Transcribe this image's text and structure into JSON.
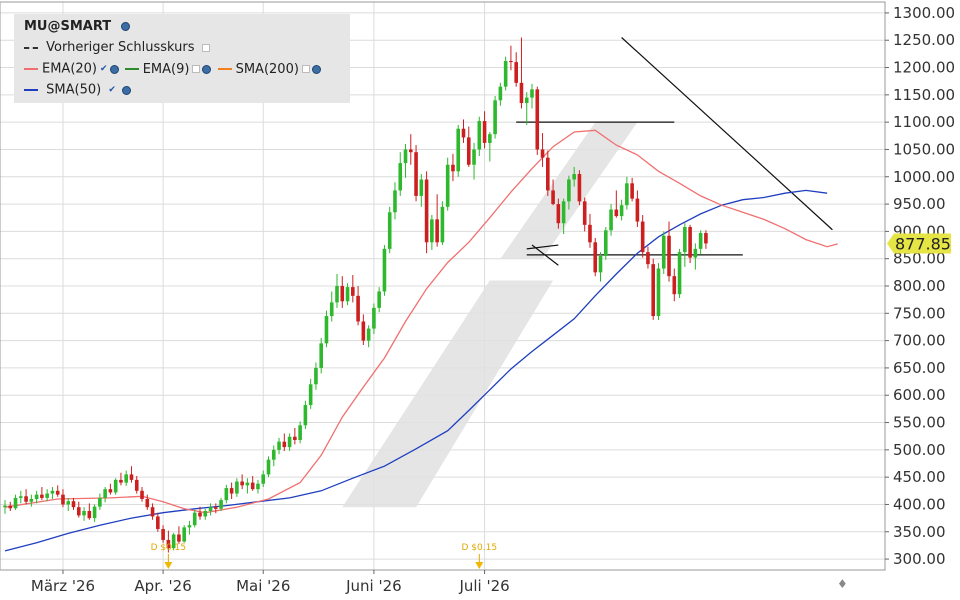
{
  "legend": {
    "title": "MU@SMART",
    "prev_close_label": "Vorheriger Schlusskurs",
    "ema20_label": "EMA(20)",
    "ema9_label": "EMA(9)",
    "sma200_label": "SMA(200)",
    "sma50_label": "SMA(50)"
  },
  "colors": {
    "up": "#2eb82e",
    "down": "#cc1f1f",
    "ema20": "#f07070",
    "ema9": "#2e8b2e",
    "sma200": "#f0821e",
    "sma50": "#1f3fbf",
    "channel": "#e0e0e0",
    "last_price_bg": "#e5e545"
  },
  "chart_data": {
    "type": "candlestick",
    "y_axis": {
      "min": 280,
      "max": 1320,
      "ticks": [
        "300.00",
        "350.00",
        "400.00",
        "450.00",
        "500.00",
        "550.00",
        "600.00",
        "650.00",
        "700.00",
        "750.00",
        "800.00",
        "850.00",
        "900.00",
        "950.00",
        "1000.00",
        "1050.00",
        "1100.00",
        "1150.00",
        "1200.00",
        "1250.00",
        "1300.00"
      ]
    },
    "x_axis": {
      "labels": [
        {
          "label": "März '26",
          "index": 11
        },
        {
          "label": "Apr. '26",
          "index": 30
        },
        {
          "label": "Mai '26",
          "index": 49
        },
        {
          "label": "Juni '26",
          "index": 70
        },
        {
          "label": "Juli '26",
          "index": 91
        }
      ]
    },
    "last_price": "877.85",
    "dividends": [
      {
        "label": "D $0.15",
        "index": 31
      },
      {
        "label": "D $0.15",
        "index": 90
      }
    ],
    "candles": [
      [
        395,
        408,
        383,
        398
      ],
      [
        398,
        405,
        388,
        393
      ],
      [
        393,
        418,
        390,
        412
      ],
      [
        412,
        425,
        402,
        415
      ],
      [
        415,
        428,
        400,
        405
      ],
      [
        405,
        418,
        396,
        410
      ],
      [
        410,
        425,
        402,
        418
      ],
      [
        418,
        432,
        408,
        412
      ],
      [
        412,
        428,
        406,
        420
      ],
      [
        420,
        432,
        410,
        425
      ],
      [
        425,
        435,
        414,
        418
      ],
      [
        418,
        428,
        395,
        400
      ],
      [
        400,
        412,
        388,
        406
      ],
      [
        406,
        412,
        390,
        395
      ],
      [
        395,
        405,
        376,
        380
      ],
      [
        380,
        395,
        370,
        388
      ],
      [
        388,
        402,
        372,
        375
      ],
      [
        375,
        400,
        368,
        396
      ],
      [
        396,
        420,
        390,
        412
      ],
      [
        412,
        432,
        404,
        428
      ],
      [
        428,
        438,
        418,
        422
      ],
      [
        422,
        448,
        418,
        445
      ],
      [
        445,
        458,
        435,
        440
      ],
      [
        440,
        462,
        434,
        455
      ],
      [
        455,
        470,
        440,
        445
      ],
      [
        445,
        452,
        420,
        425
      ],
      [
        425,
        432,
        405,
        410
      ],
      [
        410,
        418,
        390,
        395
      ],
      [
        395,
        402,
        372,
        378
      ],
      [
        378,
        385,
        350,
        355
      ],
      [
        355,
        362,
        330,
        335
      ],
      [
        335,
        352,
        312,
        320
      ],
      [
        320,
        348,
        316,
        345
      ],
      [
        345,
        360,
        328,
        332
      ],
      [
        332,
        362,
        330,
        358
      ],
      [
        358,
        370,
        345,
        362
      ],
      [
        362,
        390,
        358,
        385
      ],
      [
        385,
        396,
        372,
        378
      ],
      [
        378,
        392,
        372,
        388
      ],
      [
        388,
        402,
        380,
        395
      ],
      [
        395,
        402,
        384,
        392
      ],
      [
        392,
        412,
        388,
        408
      ],
      [
        408,
        436,
        402,
        430
      ],
      [
        430,
        440,
        410,
        420
      ],
      [
        420,
        448,
        414,
        442
      ],
      [
        442,
        455,
        428,
        435
      ],
      [
        435,
        448,
        420,
        440
      ],
      [
        440,
        452,
        425,
        428
      ],
      [
        428,
        445,
        420,
        438
      ],
      [
        438,
        462,
        432,
        455
      ],
      [
        455,
        488,
        450,
        482
      ],
      [
        482,
        508,
        470,
        500
      ],
      [
        500,
        522,
        492,
        515
      ],
      [
        515,
        530,
        498,
        505
      ],
      [
        505,
        530,
        498,
        524
      ],
      [
        524,
        540,
        510,
        518
      ],
      [
        518,
        552,
        512,
        545
      ],
      [
        545,
        590,
        538,
        582
      ],
      [
        582,
        630,
        575,
        620
      ],
      [
        620,
        660,
        610,
        650
      ],
      [
        650,
        705,
        640,
        695
      ],
      [
        695,
        755,
        688,
        745
      ],
      [
        745,
        790,
        735,
        770
      ],
      [
        770,
        822,
        760,
        800
      ],
      [
        800,
        818,
        760,
        772
      ],
      [
        772,
        805,
        765,
        798
      ],
      [
        798,
        820,
        770,
        782
      ],
      [
        782,
        800,
        728,
        735
      ],
      [
        735,
        748,
        692,
        700
      ],
      [
        700,
        728,
        688,
        722
      ],
      [
        722,
        768,
        712,
        760
      ],
      [
        760,
        798,
        752,
        790
      ],
      [
        790,
        875,
        782,
        868
      ],
      [
        868,
        945,
        860,
        935
      ],
      [
        935,
        990,
        922,
        975
      ],
      [
        975,
        1045,
        965,
        1025
      ],
      [
        1025,
        1060,
        998,
        1050
      ],
      [
        1050,
        1078,
        1022,
        1045
      ],
      [
        1045,
        1058,
        955,
        965
      ],
      [
        965,
        1005,
        945,
        995
      ],
      [
        995,
        1010,
        860,
        880
      ],
      [
        880,
        930,
        866,
        922
      ],
      [
        922,
        968,
        872,
        880
      ],
      [
        880,
        955,
        875,
        945
      ],
      [
        945,
        1035,
        938,
        1022
      ],
      [
        1022,
        1042,
        992,
        1010
      ],
      [
        1010,
        1095,
        1000,
        1088
      ],
      [
        1088,
        1105,
        1062,
        1072
      ],
      [
        1072,
        1092,
        1018,
        1022
      ],
      [
        1022,
        1062,
        995,
        1050
      ],
      [
        1050,
        1110,
        1038,
        1102
      ],
      [
        1102,
        1120,
        1052,
        1062
      ],
      [
        1062,
        1082,
        1028,
        1078
      ],
      [
        1078,
        1148,
        1070,
        1140
      ],
      [
        1140,
        1172,
        1130,
        1165
      ],
      [
        1165,
        1220,
        1158,
        1212
      ],
      [
        1212,
        1240,
        1195,
        1210
      ],
      [
        1210,
        1228,
        1165,
        1172
      ],
      [
        1172,
        1255,
        1125,
        1135
      ],
      [
        1135,
        1155,
        1095,
        1145
      ],
      [
        1145,
        1170,
        1125,
        1160
      ],
      [
        1160,
        1165,
        1040,
        1050
      ],
      [
        1050,
        1080,
        1018,
        1035
      ],
      [
        1035,
        1048,
        965,
        975
      ],
      [
        975,
        995,
        948,
        950
      ],
      [
        950,
        960,
        905,
        915
      ],
      [
        915,
        960,
        895,
        955
      ],
      [
        955,
        1002,
        940,
        995
      ],
      [
        995,
        1018,
        982,
        1005
      ],
      [
        1005,
        1012,
        948,
        955
      ],
      [
        955,
        962,
        900,
        912
      ],
      [
        912,
        932,
        870,
        880
      ],
      [
        880,
        888,
        818,
        825
      ],
      [
        825,
        862,
        808,
        855
      ],
      [
        855,
        908,
        848,
        902
      ],
      [
        902,
        950,
        892,
        940
      ],
      [
        940,
        975,
        925,
        928
      ],
      [
        928,
        958,
        920,
        948
      ],
      [
        948,
        1000,
        940,
        988
      ],
      [
        988,
        998,
        955,
        960
      ],
      [
        960,
        975,
        908,
        918
      ],
      [
        918,
        930,
        852,
        862
      ],
      [
        862,
        872,
        832,
        840
      ],
      [
        840,
        850,
        738,
        745
      ],
      [
        745,
        842,
        738,
        832
      ],
      [
        832,
        900,
        822,
        892
      ],
      [
        892,
        918,
        808,
        818
      ],
      [
        818,
        832,
        772,
        785
      ],
      [
        785,
        868,
        778,
        862
      ],
      [
        862,
        915,
        835,
        908
      ],
      [
        908,
        912,
        842,
        852
      ],
      [
        852,
        878,
        830,
        868
      ],
      [
        868,
        902,
        858,
        897
      ],
      [
        897,
        902,
        868,
        878
      ]
    ],
    "ema20": [
      [
        0,
        395
      ],
      [
        10,
        410
      ],
      [
        20,
        412
      ],
      [
        26,
        415
      ],
      [
        30,
        405
      ],
      [
        34,
        392
      ],
      [
        38,
        385
      ],
      [
        44,
        395
      ],
      [
        50,
        410
      ],
      [
        56,
        440
      ],
      [
        60,
        490
      ],
      [
        64,
        560
      ],
      [
        68,
        615
      ],
      [
        72,
        668
      ],
      [
        76,
        735
      ],
      [
        80,
        795
      ],
      [
        84,
        843
      ],
      [
        88,
        880
      ],
      [
        92,
        925
      ],
      [
        96,
        972
      ],
      [
        100,
        1015
      ],
      [
        104,
        1055
      ],
      [
        108,
        1082
      ],
      [
        112,
        1085
      ],
      [
        116,
        1058
      ],
      [
        120,
        1040
      ],
      [
        124,
        1010
      ],
      [
        128,
        988
      ],
      [
        132,
        965
      ],
      [
        136,
        948
      ],
      [
        140,
        935
      ],
      [
        144,
        922
      ],
      [
        148,
        905
      ],
      [
        152,
        885
      ],
      [
        156,
        872
      ],
      [
        158,
        877
      ]
    ],
    "sma50": [
      [
        0,
        315
      ],
      [
        6,
        330
      ],
      [
        12,
        347
      ],
      [
        18,
        362
      ],
      [
        24,
        375
      ],
      [
        30,
        385
      ],
      [
        36,
        392
      ],
      [
        42,
        398
      ],
      [
        48,
        405
      ],
      [
        54,
        412
      ],
      [
        60,
        425
      ],
      [
        66,
        448
      ],
      [
        72,
        470
      ],
      [
        78,
        502
      ],
      [
        84,
        535
      ],
      [
        88,
        572
      ],
      [
        92,
        610
      ],
      [
        96,
        648
      ],
      [
        100,
        680
      ],
      [
        104,
        710
      ],
      [
        108,
        740
      ],
      [
        112,
        782
      ],
      [
        116,
        822
      ],
      [
        120,
        860
      ],
      [
        124,
        890
      ],
      [
        128,
        912
      ],
      [
        132,
        932
      ],
      [
        136,
        948
      ],
      [
        140,
        958
      ],
      [
        144,
        962
      ],
      [
        148,
        970
      ],
      [
        152,
        975
      ],
      [
        156,
        970
      ]
    ],
    "channel": [
      [
        64,
        395
      ],
      [
        78,
        395
      ],
      [
        104,
        810
      ],
      [
        92,
        810
      ]
    ],
    "channel2": [
      [
        94,
        850
      ],
      [
        102,
        850
      ],
      [
        120,
        1100
      ],
      [
        112,
        1100
      ]
    ],
    "annotations": [
      {
        "type": "segment",
        "from": [
          97,
          1100
        ],
        "to": [
          127,
          1100
        ]
      },
      {
        "type": "segment",
        "from": [
          99,
          857
        ],
        "to": [
          140,
          857
        ]
      },
      {
        "type": "segment",
        "from": [
          117,
          1255
        ],
        "to": [
          157,
          903
        ]
      },
      {
        "type": "segment",
        "from": [
          100,
          875
        ],
        "to": [
          105,
          838
        ]
      },
      {
        "type": "segment",
        "from": [
          99,
          868
        ],
        "to": [
          105,
          875
        ]
      }
    ]
  }
}
